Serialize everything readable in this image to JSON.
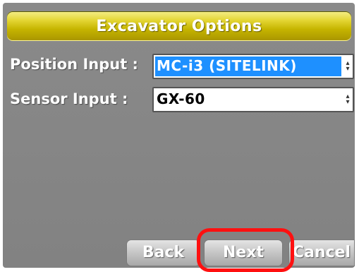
{
  "window": {
    "title": "Excavator Options"
  },
  "form": {
    "position_input": {
      "label": "Position Input :",
      "value": "MC-i3 (SITELINK)"
    },
    "sensor_input": {
      "label": "Sensor Input :",
      "value": "GX-60"
    }
  },
  "buttons": {
    "back": "Back",
    "next": "Next",
    "cancel": "Cancel"
  },
  "icons": {
    "dropdown": "dropdown-arrow-icon"
  },
  "colors": {
    "title_bar": "#c6b500",
    "selection_highlight": "#1e90ff",
    "annotation_ring": "#ff1010",
    "background": "#858585"
  }
}
